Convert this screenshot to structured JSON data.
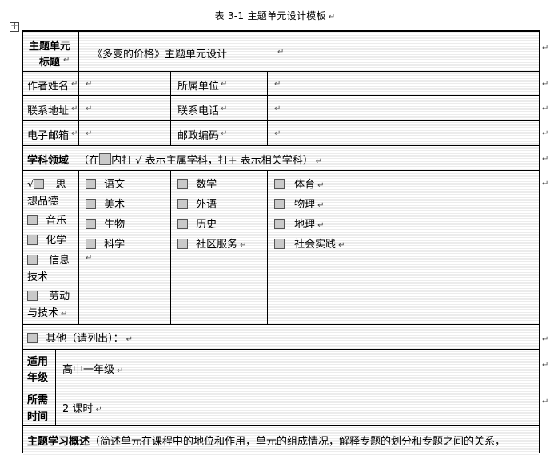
{
  "caption": "表 3-1   主题单元设计模板",
  "para_mark": "↵",
  "rows": {
    "topic_title": {
      "label_line1": "主题单元",
      "label_line2": "标题",
      "value": "《多变的价格》主题单元设计"
    },
    "author": {
      "label": "作者姓名",
      "label2": "所属单位"
    },
    "address": {
      "label": "联系地址",
      "label2": "联系电话"
    },
    "email": {
      "label": "电子邮箱",
      "label2": "邮政编码"
    },
    "subject_area": {
      "label": "学科领域",
      "hint_prefix": "（在",
      "hint_suffix": "内打 √  表示主属学科，打+ 表示相关学科）"
    },
    "subjects": {
      "col1": {
        "politics_check": "√",
        "politics_line1": "思",
        "politics_line2": "想品德",
        "music": "音乐",
        "chemistry": "化学",
        "it_line1": "信息",
        "it_line2": "技术",
        "labor_line1": "劳动",
        "labor_line2": "与技术"
      },
      "col2": [
        "语文",
        "美术",
        "生物",
        "科学"
      ],
      "col3": [
        "数学",
        "外语",
        "历史",
        "社区服务"
      ],
      "col4": [
        "体育",
        "物理",
        "地理",
        "社会实践"
      ]
    },
    "other": {
      "label": "其他（请列出）："
    },
    "grade": {
      "label_line1": "适用",
      "label_line2": "年级",
      "value": "高中一年级"
    },
    "time": {
      "label_line1": "所需",
      "label_line2": "时间",
      "value": "2 课时"
    },
    "overview": {
      "label": "主题学习概述",
      "text": "（简述单元在课程中的地位和作用，单元的组成情况，解释专题的划分和专题之间的关系，"
    }
  }
}
